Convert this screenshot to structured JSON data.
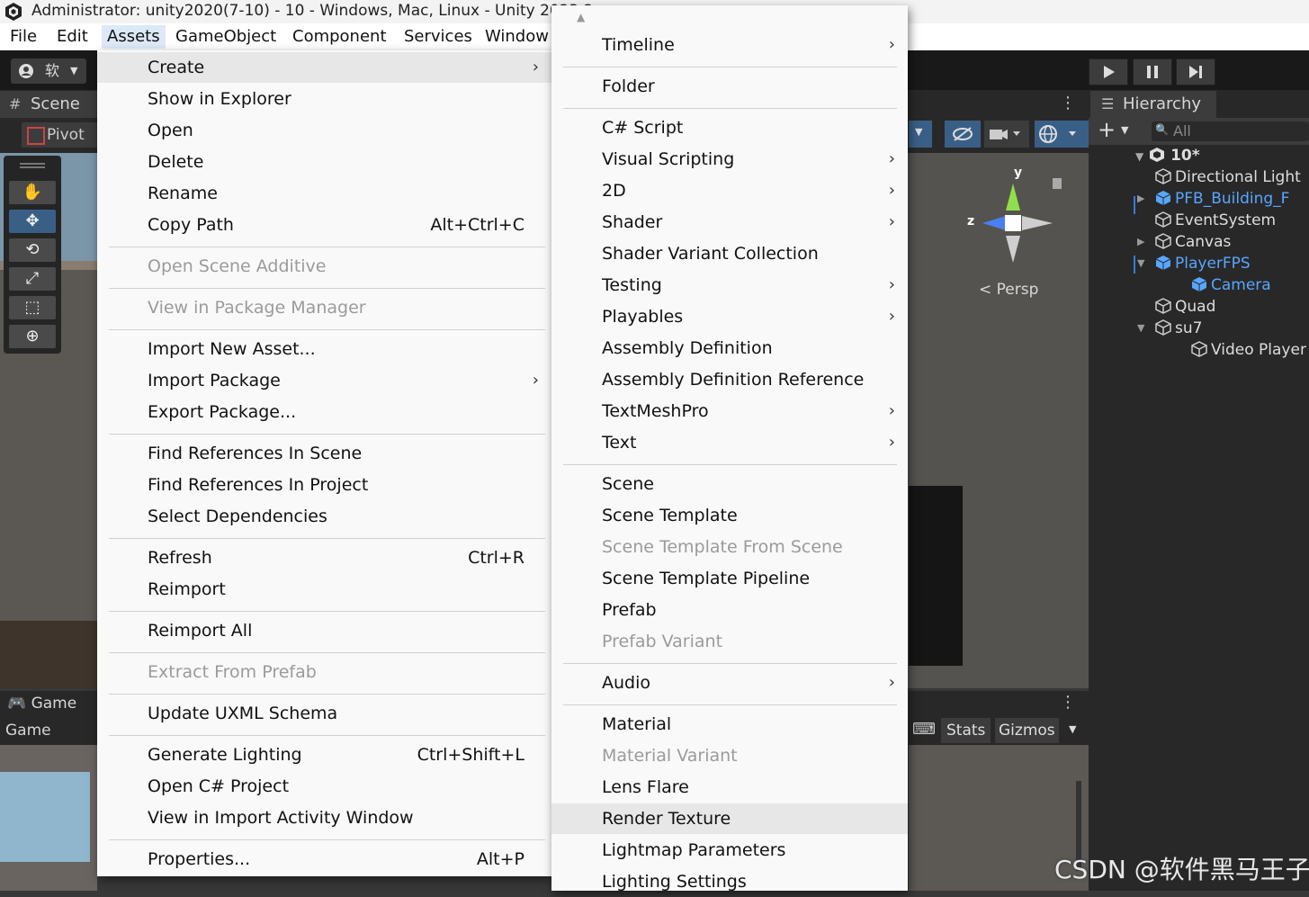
{
  "window": {
    "title": "Administrator: unity2020(7-10) - 10 - Windows, Mac, Linux - Unity 2023.2"
  },
  "menubar": [
    "File",
    "Edit",
    "Assets",
    "GameObject",
    "Component",
    "Services",
    "Window"
  ],
  "toolbar": {
    "account_label": "软"
  },
  "scene_panel": {
    "tab": "Scene",
    "pivot_label": "Pivot",
    "persp_label": "Persp",
    "axis_y": "y",
    "axis_z": "z"
  },
  "game_panel": {
    "tab": "Game",
    "sub": "Game",
    "stats": "Stats",
    "gizmos": "Gizmos"
  },
  "hierarchy": {
    "tab": "Hierarchy",
    "search_placeholder": "All",
    "root": "10*",
    "items": [
      {
        "label": "Directional Light",
        "blue": false,
        "indent": 1,
        "expander": ""
      },
      {
        "label": "PFB_Building_F",
        "blue": true,
        "indent": 1,
        "expander": "right"
      },
      {
        "label": "EventSystem",
        "blue": false,
        "indent": 1,
        "expander": ""
      },
      {
        "label": "Canvas",
        "blue": false,
        "indent": 1,
        "expander": "right"
      },
      {
        "label": "PlayerFPS",
        "blue": true,
        "indent": 1,
        "expander": "down"
      },
      {
        "label": "Camera",
        "blue": true,
        "indent": 2,
        "expander": ""
      },
      {
        "label": "Quad",
        "blue": false,
        "indent": 1,
        "expander": ""
      },
      {
        "label": "su7",
        "blue": false,
        "indent": 1,
        "expander": "down"
      },
      {
        "label": "Video Player",
        "blue": false,
        "indent": 2,
        "expander": ""
      }
    ]
  },
  "assets_menu": [
    {
      "label": "Create",
      "submenu": true,
      "highlight": true
    },
    {
      "label": "Show in Explorer"
    },
    {
      "label": "Open"
    },
    {
      "label": "Delete"
    },
    {
      "label": "Rename"
    },
    {
      "label": "Copy Path",
      "shortcut": "Alt+Ctrl+C"
    },
    {
      "sep": true
    },
    {
      "label": "Open Scene Additive",
      "disabled": true
    },
    {
      "sep": true
    },
    {
      "label": "View in Package Manager",
      "disabled": true
    },
    {
      "sep": true
    },
    {
      "label": "Import New Asset..."
    },
    {
      "label": "Import Package",
      "submenu": true
    },
    {
      "label": "Export Package..."
    },
    {
      "sep": true
    },
    {
      "label": "Find References In Scene"
    },
    {
      "label": "Find References In Project"
    },
    {
      "label": "Select Dependencies"
    },
    {
      "sep": true
    },
    {
      "label": "Refresh",
      "shortcut": "Ctrl+R"
    },
    {
      "label": "Reimport"
    },
    {
      "sep": true
    },
    {
      "label": "Reimport All"
    },
    {
      "sep": true
    },
    {
      "label": "Extract From Prefab",
      "disabled": true
    },
    {
      "sep": true
    },
    {
      "label": "Update UXML Schema"
    },
    {
      "sep": true
    },
    {
      "label": "Generate Lighting",
      "shortcut": "Ctrl+Shift+L"
    },
    {
      "label": "Open C# Project"
    },
    {
      "label": "View in Import Activity Window"
    },
    {
      "sep": true
    },
    {
      "label": "Properties...",
      "shortcut": "Alt+P"
    }
  ],
  "create_menu": [
    {
      "label": "Timeline",
      "submenu": true
    },
    {
      "sep": true
    },
    {
      "label": "Folder"
    },
    {
      "sep": true
    },
    {
      "label": "C# Script"
    },
    {
      "label": "Visual Scripting",
      "submenu": true
    },
    {
      "label": "2D",
      "submenu": true
    },
    {
      "label": "Shader",
      "submenu": true
    },
    {
      "label": "Shader Variant Collection"
    },
    {
      "label": "Testing",
      "submenu": true
    },
    {
      "label": "Playables",
      "submenu": true
    },
    {
      "label": "Assembly Definition"
    },
    {
      "label": "Assembly Definition Reference"
    },
    {
      "label": "TextMeshPro",
      "submenu": true
    },
    {
      "label": "Text",
      "submenu": true
    },
    {
      "sep": true
    },
    {
      "label": "Scene"
    },
    {
      "label": "Scene Template"
    },
    {
      "label": "Scene Template From Scene",
      "disabled": true
    },
    {
      "label": "Scene Template Pipeline"
    },
    {
      "label": "Prefab"
    },
    {
      "label": "Prefab Variant",
      "disabled": true
    },
    {
      "sep": true
    },
    {
      "label": "Audio",
      "submenu": true
    },
    {
      "sep": true
    },
    {
      "label": "Material"
    },
    {
      "label": "Material Variant",
      "disabled": true
    },
    {
      "label": "Lens Flare"
    },
    {
      "label": "Render Texture",
      "highlight": true
    },
    {
      "label": "Lightmap Parameters"
    },
    {
      "label": "Lighting Settings"
    }
  ],
  "watermark": "CSDN @软件黑马王子"
}
